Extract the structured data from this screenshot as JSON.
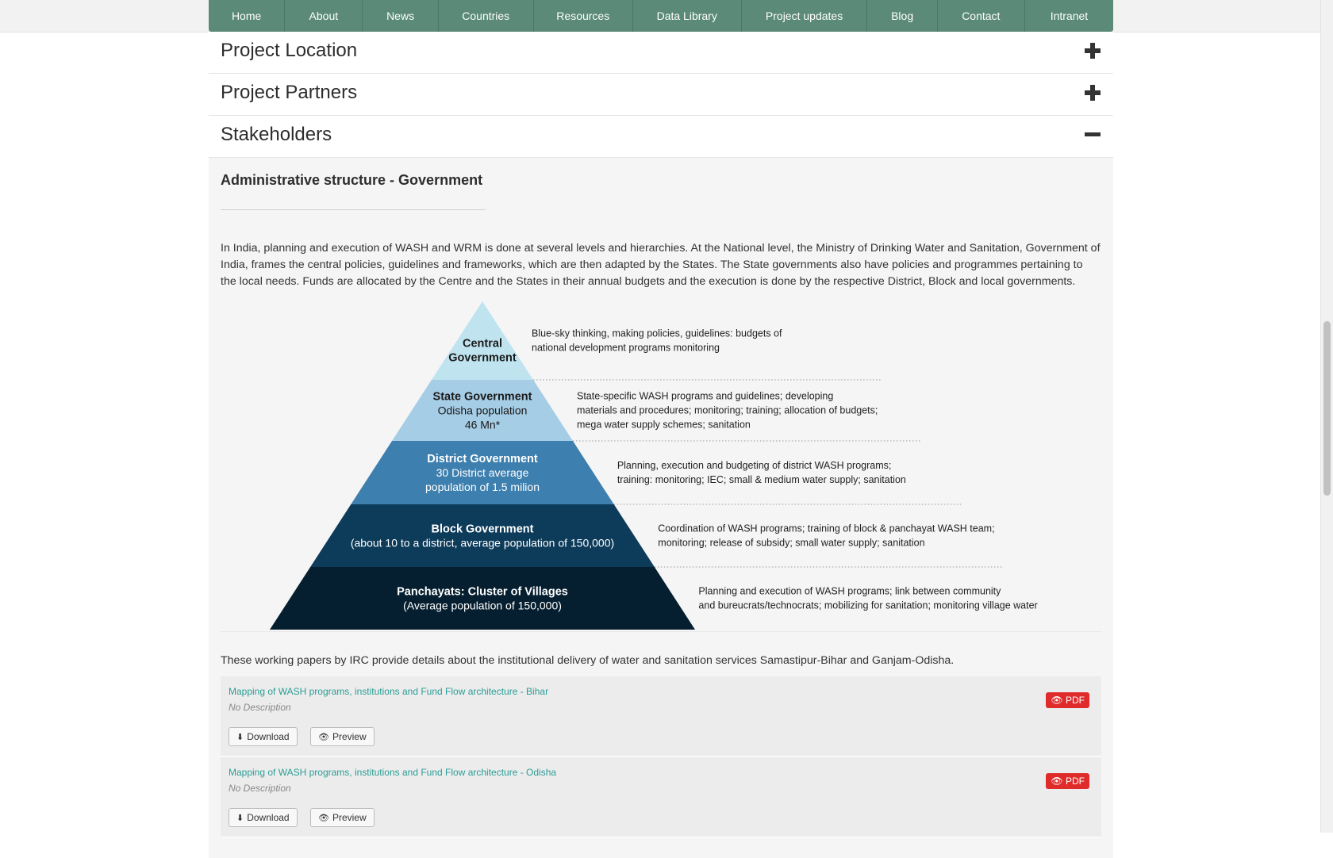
{
  "nav": [
    "Home",
    "About",
    "News",
    "Countries",
    "Resources",
    "Data Library",
    "Project updates",
    "Blog",
    "Contact",
    "Intranet"
  ],
  "accordion": {
    "location": "Project Location",
    "partners": "Project Partners",
    "stakeholders": "Stakeholders"
  },
  "stakeholders": {
    "subtitle": "Administrative structure - Government",
    "paragraph": "In India, planning and execution of WASH and WRM is done at several levels and hierarchies. At the National level, the Ministry of Drinking Water and Sanitation, Government of India, frames the central policies, guidelines and frameworks, which are then adapted by the States. The State governments also have policies and programmes pertaining to the local needs. Funds are allocated by the Centre and the States in their annual budgets and the execution is done by the respective District, Block and local governments.",
    "pyramid": [
      {
        "label1": "Central",
        "label2": "Government",
        "label3": "",
        "desc1": "Blue-sky thinking, making policies, guidelines: budgets of",
        "desc2": "national development programs monitoring",
        "desc3": "",
        "color": "#bfe4ef"
      },
      {
        "label1": "State Government",
        "label2": "Odisha population",
        "label3": "46 Mn*",
        "desc1": "State-specific WASH programs and guidelines; developing",
        "desc2": "materials and procedures; monitoring; training; allocation of budgets;",
        "desc3": "mega water supply schemes; sanitation",
        "color": "#a6cde6"
      },
      {
        "label1": "District Government",
        "label2": "30 District average",
        "label3": "population of 1.5 milion",
        "desc1": "Planning, execution and budgeting of district WASH programs;",
        "desc2": "training: monitoring; IEC; small & medium water supply; sanitation",
        "desc3": "",
        "color": "#3d7fae"
      },
      {
        "label1": "Block Government",
        "label2": "(about 10 to a district, average population of 150,000)",
        "label3": "",
        "desc1": "Coordination of WASH programs; training of block & panchayat WASH team;",
        "desc2": "monitoring; release of subsidy; small water supply; sanitation",
        "desc3": "",
        "color": "#0d3b5a"
      },
      {
        "label1": "Panchayats: Cluster of Villages",
        "label2": "(Average population of 150,000)",
        "label3": "",
        "desc1": "Planning and execution of WASH programs; link between community",
        "desc2": "and bureucrats/technocrats; mobilizing for sanitation; monitoring village water",
        "desc3": "",
        "color": "#061f30"
      }
    ],
    "intro": "These working papers by IRC provide details about the institutional delivery of water and sanitation services Samastipur-Bihar and Ganjam-Odisha.",
    "documents": [
      {
        "title": "Mapping of WASH programs, institutions and Fund Flow architecture - Bihar",
        "description": "No Description",
        "badge": "PDF",
        "download": "Download",
        "preview": "Preview"
      },
      {
        "title": "Mapping of WASH programs, institutions and Fund Flow architecture - Odisha",
        "description": "No Description",
        "badge": "PDF",
        "download": "Download",
        "preview": "Preview"
      }
    ]
  }
}
